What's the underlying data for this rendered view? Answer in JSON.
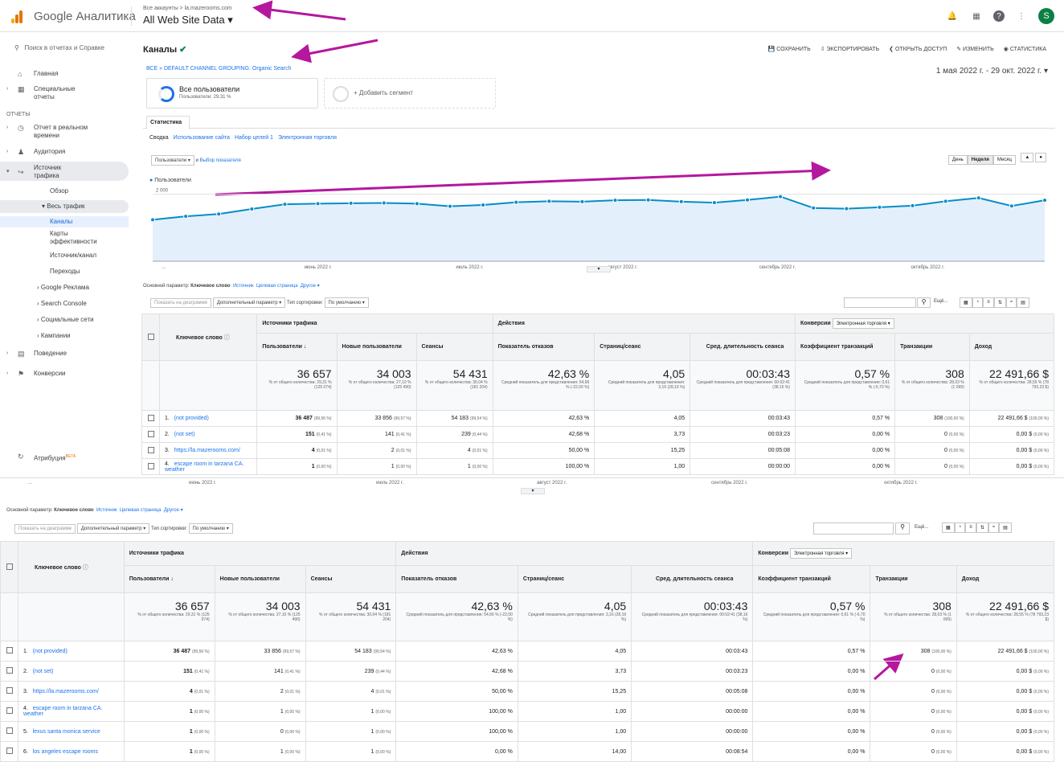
{
  "app": {
    "name": "Google Аналитика",
    "crumb": "Все аккаунты > la.mazerooms.com",
    "property": "All Web Site Data ▾",
    "avatar": "S"
  },
  "sidebar": {
    "search": "Поиск в отчетах и Справке",
    "section": "ОТЧЕТЫ",
    "items": [
      {
        "label": "Главная"
      },
      {
        "label": "Специальные отчеты"
      },
      {
        "label": "Отчет в реальном времени"
      },
      {
        "label": "Аудитория"
      },
      {
        "label": "Источник трафика"
      },
      {
        "label": "Обзор"
      },
      {
        "label": "Весь трафик"
      },
      {
        "label": "Каналы"
      },
      {
        "label": "Карты эффективности"
      },
      {
        "label": "Источник/канал"
      },
      {
        "label": "Переходы"
      },
      {
        "label": "Google Реклама"
      },
      {
        "label": "Search Console"
      },
      {
        "label": "Социальные сети"
      },
      {
        "label": "Кампании"
      },
      {
        "label": "Поведение"
      },
      {
        "label": "Конверсии"
      }
    ],
    "attribution": "Атрибуция",
    "beta": "BETA"
  },
  "page": {
    "title": "Каналы",
    "grouping": "ВСЕ » DEFAULT CHANNEL GROUPING: Organic Search",
    "date": "1 мая 2022 г. - 29 окт. 2022 г."
  },
  "toolbar": {
    "save": "СОХРАНИТЬ",
    "export": "ЭКСПОРТИРОВАТЬ",
    "share": "ОТКРЫТЬ ДОСТУП",
    "edit": "ИЗМЕНИТЬ",
    "insights": "СТАТИСТИКА"
  },
  "segment": {
    "name": "Все пользователи",
    "sub": "Пользователи: 29,31 %",
    "add": "+ Добавить сегмент"
  },
  "tabs": {
    "main": "Статистика",
    "sub": [
      "Сводка",
      "Использование сайта",
      "Набор целей 1",
      "Электронная торговля"
    ]
  },
  "chartctl": {
    "metric": "Пользователи",
    "and": "и",
    "choose": "Выбор показателя",
    "gran": [
      "День",
      "Неделя",
      "Месяц"
    ]
  },
  "chart_data": {
    "type": "line",
    "series": [
      {
        "name": "Пользователи",
        "values": [
          1240,
          1340,
          1410,
          1560,
          1700,
          1720,
          1730,
          1740,
          1720,
          1640,
          1680,
          1760,
          1790,
          1780,
          1820,
          1830,
          1780,
          1750,
          1830,
          1930,
          1590,
          1570,
          1610,
          1660,
          1790,
          1890,
          1650,
          1820
        ]
      }
    ],
    "yticks": [
      "2 000",
      "1 000"
    ],
    "xticks": [
      "...",
      "июнь 2022 г.",
      "июль 2022 г.",
      "август 2022 г.",
      "сентябрь 2022 г.",
      "октябрь 2022 г."
    ],
    "ylim": [
      0,
      2400
    ]
  },
  "opts": {
    "primary": "Основной параметр:",
    "primary_val": "Ключевое слово",
    "links": [
      "Источник",
      "Целевая страница",
      "Другое ▾"
    ],
    "plot": "Показать на диаграмме",
    "secondary": "Дополнительный параметр ▾",
    "sort": "Тип сортировки:",
    "sort_val": "По умолчанию ▾",
    "more": "Ещё..."
  },
  "table": {
    "dim": "Ключевое слово",
    "groups": [
      "Источники трафика",
      "Действия",
      "Конверсии"
    ],
    "conv_sel": "Электронная торговля ▾",
    "cols": [
      "Пользователи",
      "Новые пользователи",
      "Сеансы",
      "Показатель отказов",
      "Страниц/сеанс",
      "Сред. длительность сеанса",
      "Коэффициент транзакций",
      "Транзакции",
      "Доход"
    ],
    "totals": [
      {
        "v": "36 657",
        "s": "% от общего количества: 29,31 % (125 074)"
      },
      {
        "v": "34 003",
        "s": "% от общего количества: 27,10 % (125 490)"
      },
      {
        "v": "54 431",
        "s": "% от общего количества: 30,04 % (181 204)"
      },
      {
        "v": "42,63 %",
        "s": "Средний показатель для представления: 54,66 % (-22,00 %)"
      },
      {
        "v": "4,05",
        "s": "Средний показатель для представления: 3,16 (28,19 %)"
      },
      {
        "v": "00:03:43",
        "s": "Средний показатель для представления: 00:02:41 (38,16 %)"
      },
      {
        "v": "0,57 %",
        "s": "Средний показатель для представления: 0,61 % (-6,70 %)"
      },
      {
        "v": "308",
        "s": "% от общего количества: 28,03 % (1 099)"
      },
      {
        "v": "22 491,66 $",
        "s": "% от общего количества: 28,55 % (78 793,23 $)"
      }
    ],
    "rows": [
      {
        "n": "1.",
        "k": "(not provided)",
        "c": [
          "36 487",
          "(99,56 %)",
          "33 856",
          "(99,57 %)",
          "54 183",
          "(99,54 %)",
          "42,63 %",
          "4,05",
          "00:03:43",
          "0,57 %",
          "308",
          "(100,00 %)",
          "22 491,66 $",
          "(100,00 %)"
        ]
      },
      {
        "n": "2.",
        "k": "(not set)",
        "c": [
          "151",
          "(0,41 %)",
          "141",
          "(0,41 %)",
          "239",
          "(0,44 %)",
          "42,68 %",
          "3,73",
          "00:03:23",
          "0,00 %",
          "0",
          "(0,00 %)",
          "0,00 $",
          "(0,00 %)"
        ]
      },
      {
        "n": "3.",
        "k": "https://la.mazerooms.com/",
        "c": [
          "4",
          "(0,01 %)",
          "2",
          "(0,01 %)",
          "4",
          "(0,01 %)",
          "50,00 %",
          "15,25",
          "00:05:08",
          "0,00 %",
          "0",
          "(0,00 %)",
          "0,00 $",
          "(0,00 %)"
        ]
      },
      {
        "n": "4.",
        "k": "escape room in tarzana CA. weather",
        "c": [
          "1",
          "(0,00 %)",
          "1",
          "(0,00 %)",
          "1",
          "(0,00 %)",
          "100,00 %",
          "1,00",
          "00:00:00",
          "0,00 %",
          "0",
          "(0,00 %)",
          "0,00 $",
          "(0,00 %)"
        ]
      },
      {
        "n": "5.",
        "k": "lexus santa monica service",
        "c": [
          "1",
          "(0,00 %)",
          "0",
          "(0,00 %)",
          "1",
          "(0,00 %)",
          "100,00 %",
          "1,00",
          "00:00:00",
          "0,00 %",
          "0",
          "(0,00 %)",
          "0,00 $",
          "(0,00 %)"
        ]
      },
      {
        "n": "6.",
        "k": "los angeles escape rooms",
        "c": [
          "1",
          "(0,00 %)",
          "1",
          "(0,00 %)",
          "1",
          "(0,00 %)",
          "0,00 %",
          "14,00",
          "00:08:54",
          "0,00 %",
          "0",
          "(0,00 %)",
          "0,00 $",
          "(0,00 %)"
        ]
      }
    ]
  }
}
